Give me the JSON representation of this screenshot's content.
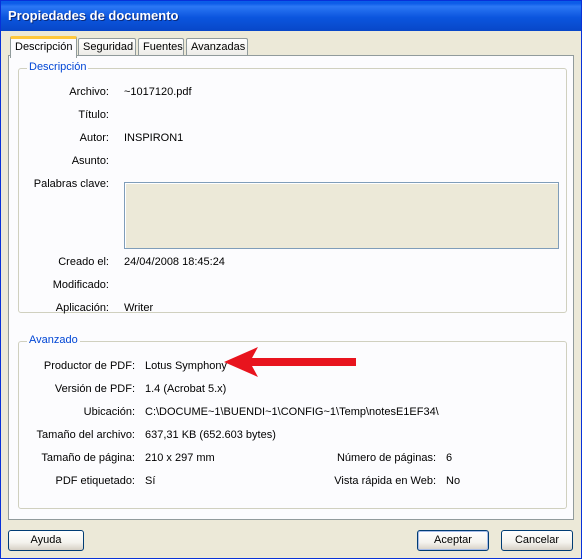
{
  "window": {
    "title": "Propiedades de documento"
  },
  "tabs": [
    {
      "label": "Descripción"
    },
    {
      "label": "Seguridad"
    },
    {
      "label": "Fuentes"
    },
    {
      "label": "Avanzadas"
    }
  ],
  "description": {
    "group_title": "Descripción",
    "archivo": {
      "label": "Archivo:",
      "value": "~1017120.pdf"
    },
    "titulo": {
      "label": "Título:",
      "value": ""
    },
    "autor": {
      "label": "Autor:",
      "value": "INSPIRON1"
    },
    "asunto": {
      "label": "Asunto:",
      "value": ""
    },
    "palabras": {
      "label": "Palabras clave:",
      "value": ""
    },
    "creado": {
      "label": "Creado el:",
      "value": "24/04/2008 18:45:24"
    },
    "modificado": {
      "label": "Modificado:",
      "value": ""
    },
    "aplicacion": {
      "label": "Aplicación:",
      "value": "Writer"
    }
  },
  "advanced": {
    "group_title": "Avanzado",
    "productor": {
      "label": "Productor de PDF:",
      "value": "Lotus Symphony"
    },
    "version": {
      "label": "Versión de PDF:",
      "value": "1.4 (Acrobat 5.x)"
    },
    "ubicacion": {
      "label": "Ubicación:",
      "value": "C:\\DOCUME~1\\BUENDI~1\\CONFIG~1\\Temp\\notesE1EF34\\"
    },
    "tamano_archivo": {
      "label": "Tamaño del archivo:",
      "value": "637,31 KB (652.603 bytes)"
    },
    "tamano_pagina": {
      "label": "Tamaño de página:",
      "value": "210 x 297 mm"
    },
    "numero_paginas": {
      "label": "Número de páginas:",
      "value": "6"
    },
    "etiquetado": {
      "label": "PDF etiquetado:",
      "value": "Sí"
    },
    "vista_rapida": {
      "label": "Vista rápida en Web:",
      "value": "No"
    }
  },
  "buttons": {
    "help": "Ayuda",
    "ok": "Aceptar",
    "cancel": "Cancelar"
  },
  "annotation": {
    "arrow_color": "#E8141E",
    "arrow_icon": "left-arrow-icon"
  }
}
